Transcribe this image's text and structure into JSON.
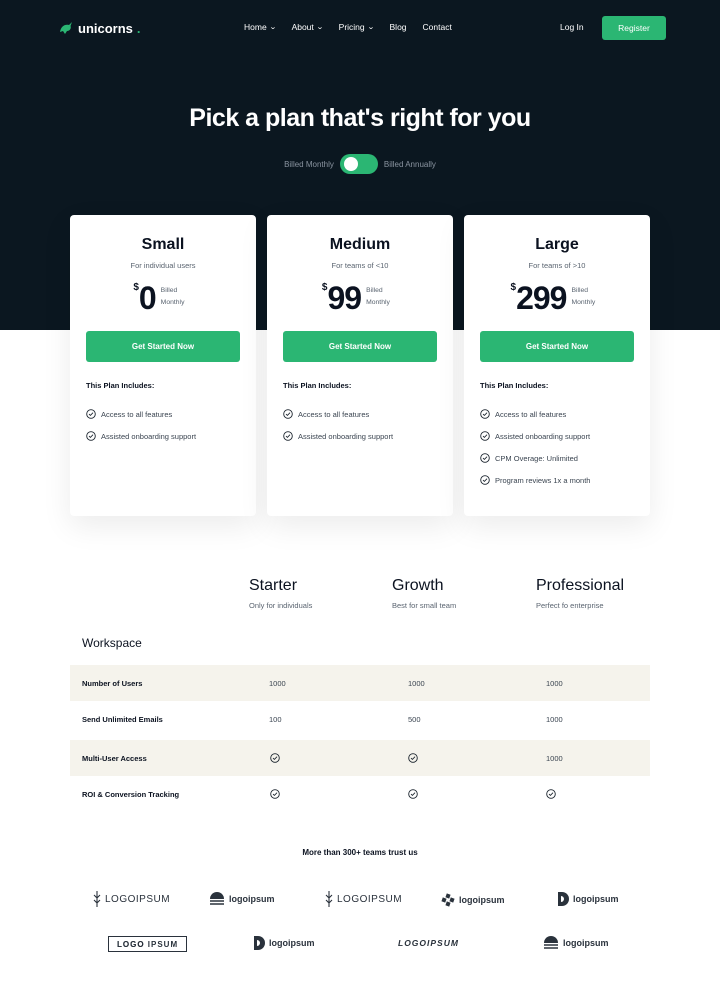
{
  "nav": {
    "logo": "unicorns",
    "items": [
      {
        "label": "Home",
        "dropdown": true
      },
      {
        "label": "About",
        "dropdown": true
      },
      {
        "label": "Pricing",
        "dropdown": true
      },
      {
        "label": "Blog",
        "dropdown": false
      },
      {
        "label": "Contact",
        "dropdown": false
      }
    ],
    "login": "Log In",
    "register": "Register"
  },
  "hero": {
    "title": "Pick a plan that's right for you",
    "billed_monthly": "Billed Monthly",
    "billed_annually": "Billed Annually"
  },
  "plans": [
    {
      "name": "Small",
      "subtitle": "For individual users",
      "currency": "$",
      "price": "0",
      "billed": "Billed Monthly",
      "cta": "Get Started Now",
      "includes": "This Plan Includes:",
      "features": [
        "Access to all features",
        "Assisted onboarding support"
      ]
    },
    {
      "name": "Medium",
      "subtitle": "For teams of <10",
      "currency": "$",
      "price": "99",
      "billed": "Billed Monthly",
      "cta": "Get Started Now",
      "includes": "This Plan Includes:",
      "features": [
        "Access to all features",
        "Assisted onboarding support"
      ]
    },
    {
      "name": "Large",
      "subtitle": "For teams of >10",
      "currency": "$",
      "price": "299",
      "billed": "Billed Monthly",
      "cta": "Get Started Now",
      "includes": "This Plan Includes:",
      "features": [
        "Access to all features",
        "Assisted onboarding support",
        "CPM Overage: Unlimited",
        "Program reviews 1x a month"
      ]
    }
  ],
  "comparison": {
    "tiers": [
      {
        "name": "Starter",
        "subtitle": "Only for individuals"
      },
      {
        "name": "Growth",
        "subtitle": "Best for small team"
      },
      {
        "name": "Professional",
        "subtitle": "Perfect fo enterprise"
      }
    ],
    "section": "Workspace",
    "rows": [
      {
        "label": "Number of Users",
        "values": [
          "1000",
          "1000",
          "1000"
        ]
      },
      {
        "label": "Send Unlimited Emails",
        "values": [
          "100",
          "500",
          "1000"
        ]
      },
      {
        "label": "Multi-User Access",
        "values": [
          "check",
          "check",
          "1000"
        ]
      },
      {
        "label": "ROI & Conversion Tracking",
        "values": [
          "check",
          "check",
          "check"
        ]
      }
    ]
  },
  "trust": {
    "title": "More than 300+ teams trust us",
    "logos": [
      "LOGOIPSUM",
      "logoipsum",
      "LOGOIPSUM",
      "logoipsum",
      "logoipsum",
      "LOGO IPSUM",
      "logoipsum",
      "LOGOIPSUM",
      "logoipsum"
    ]
  },
  "colors": {
    "accent": "#2bb673",
    "hero_bg": "#0b1720",
    "row_shade": "#f5f3ec"
  }
}
